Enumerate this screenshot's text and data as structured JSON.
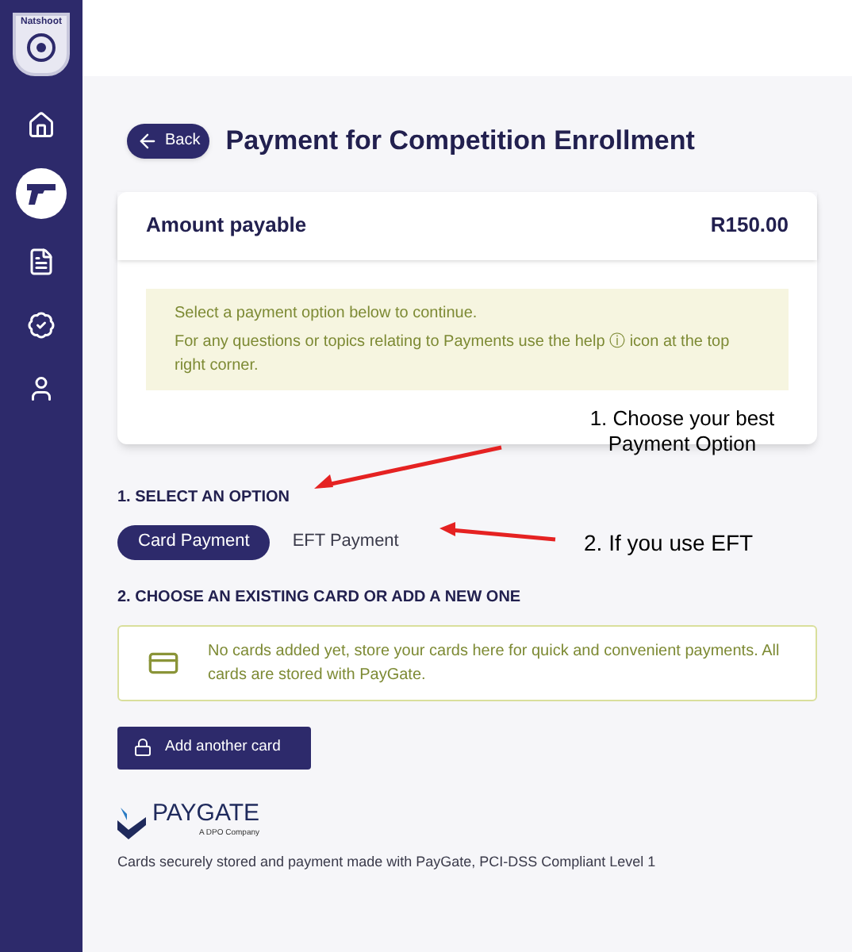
{
  "sidebar": {
    "logo_text": "Natshoot",
    "items": [
      {
        "selected": false
      },
      {
        "selected": true
      },
      {
        "selected": false
      },
      {
        "selected": false
      },
      {
        "selected": false
      }
    ]
  },
  "header": {
    "back": "Back",
    "title": "Payment for Competition Enrollment"
  },
  "amount": {
    "label": "Amount payable",
    "value": "R150.00"
  },
  "notice": [
    "Select a payment option below to continue.",
    "For any questions or topics relating to Payments use the help ⓘ icon at the top right corner."
  ],
  "section_1": {
    "title": "1. SELECT AN OPTION",
    "tabs": [
      {
        "label": "Card Payment",
        "selected": true
      },
      {
        "label": "EFT Payment",
        "selected": false
      }
    ]
  },
  "section_2": {
    "title": "2. CHOOSE AN EXISTING CARD OR ADD A NEW ONE",
    "info": "No cards added yet, store your cards here for quick and convenient payments. All cards are stored with PayGate.",
    "button": "Add another card"
  },
  "paygate": {
    "name": "PAYGATE",
    "tagline": "A DPO Company",
    "note": "Cards securely stored and payment made with PayGate, PCI-DSS Compliant Level 1"
  },
  "annotations": [
    "1.  Choose your best Payment Option",
    "2.  If you use EFT"
  ]
}
